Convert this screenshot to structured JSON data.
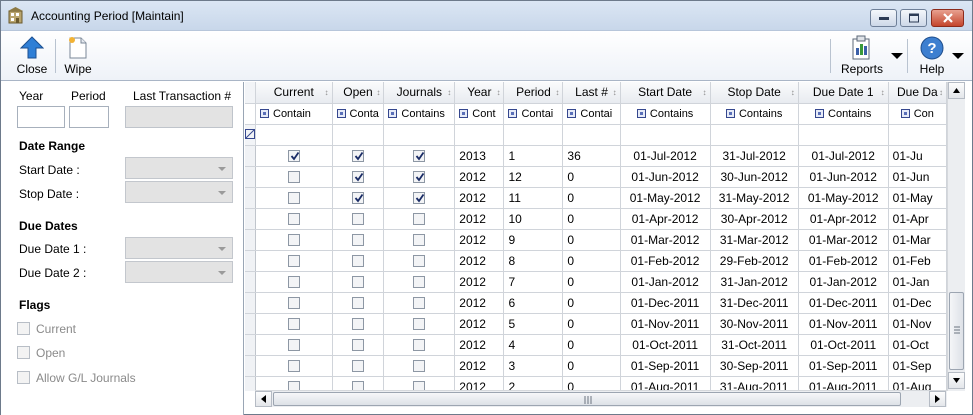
{
  "window": {
    "title": "Accounting Period [Maintain]",
    "icons": {
      "app": "building-icon",
      "minimize": "minimize-icon",
      "maximize": "maximize-icon",
      "close": "close-icon"
    }
  },
  "toolbar": {
    "close_label": "Close",
    "wipe_label": "Wipe",
    "reports_label": "Reports",
    "help_label": "Help"
  },
  "filters": {
    "year_label": "Year",
    "period_label": "Period",
    "last_transaction_label": "Last Transaction #",
    "date_range_heading": "Date Range",
    "start_date_label": "Start Date :",
    "stop_date_label": "Stop Date :",
    "due_dates_heading": "Due Dates",
    "due_date_1_label": "Due Date 1 :",
    "due_date_2_label": "Due Date 2 :",
    "flags_heading": "Flags",
    "flag_current": "Current",
    "flag_open": "Open",
    "flag_journals": "Allow G/L Journals"
  },
  "grid": {
    "columns": [
      "Current",
      "Open",
      "Journals",
      "Year",
      "Period",
      "Last #",
      "Start Date",
      "Stop Date",
      "Due Date 1",
      "Due Da"
    ],
    "filter_row": [
      "Contain",
      "Conta",
      "Contains",
      "Cont",
      "Contai",
      "Contai",
      "Contains",
      "Contains",
      "Contains",
      "Con"
    ],
    "rows": [
      {
        "current": true,
        "open": true,
        "journals": true,
        "year": "2013",
        "period": "1",
        "last": "36",
        "start": "01-Jul-2012",
        "stop": "31-Jul-2012",
        "due1": "01-Jul-2012",
        "due2": "01-Ju"
      },
      {
        "current": false,
        "open": true,
        "journals": true,
        "year": "2012",
        "period": "12",
        "last": "0",
        "start": "01-Jun-2012",
        "stop": "30-Jun-2012",
        "due1": "01-Jun-2012",
        "due2": "01-Jun"
      },
      {
        "current": false,
        "open": true,
        "journals": true,
        "year": "2012",
        "period": "11",
        "last": "0",
        "start": "01-May-2012",
        "stop": "31-May-2012",
        "due1": "01-May-2012",
        "due2": "01-May"
      },
      {
        "current": false,
        "open": false,
        "journals": false,
        "year": "2012",
        "period": "10",
        "last": "0",
        "start": "01-Apr-2012",
        "stop": "30-Apr-2012",
        "due1": "01-Apr-2012",
        "due2": "01-Apr"
      },
      {
        "current": false,
        "open": false,
        "journals": false,
        "year": "2012",
        "period": "9",
        "last": "0",
        "start": "01-Mar-2012",
        "stop": "31-Mar-2012",
        "due1": "01-Mar-2012",
        "due2": "01-Mar"
      },
      {
        "current": false,
        "open": false,
        "journals": false,
        "year": "2012",
        "period": "8",
        "last": "0",
        "start": "01-Feb-2012",
        "stop": "29-Feb-2012",
        "due1": "01-Feb-2012",
        "due2": "01-Feb"
      },
      {
        "current": false,
        "open": false,
        "journals": false,
        "year": "2012",
        "period": "7",
        "last": "0",
        "start": "01-Jan-2012",
        "stop": "31-Jan-2012",
        "due1": "01-Jan-2012",
        "due2": "01-Jan"
      },
      {
        "current": false,
        "open": false,
        "journals": false,
        "year": "2012",
        "period": "6",
        "last": "0",
        "start": "01-Dec-2011",
        "stop": "31-Dec-2011",
        "due1": "01-Dec-2011",
        "due2": "01-Dec"
      },
      {
        "current": false,
        "open": false,
        "journals": false,
        "year": "2012",
        "period": "5",
        "last": "0",
        "start": "01-Nov-2011",
        "stop": "30-Nov-2011",
        "due1": "01-Nov-2011",
        "due2": "01-Nov"
      },
      {
        "current": false,
        "open": false,
        "journals": false,
        "year": "2012",
        "period": "4",
        "last": "0",
        "start": "01-Oct-2011",
        "stop": "31-Oct-2011",
        "due1": "01-Oct-2011",
        "due2": "01-Oct"
      },
      {
        "current": false,
        "open": false,
        "journals": false,
        "year": "2012",
        "period": "3",
        "last": "0",
        "start": "01-Sep-2011",
        "stop": "30-Sep-2011",
        "due1": "01-Sep-2011",
        "due2": "01-Sep"
      },
      {
        "current": false,
        "open": false,
        "journals": false,
        "year": "2012",
        "period": "2",
        "last": "0",
        "start": "01-Aug-2011",
        "stop": "31-Aug-2011",
        "due1": "01-Aug-2011",
        "due2": "01-Aug"
      }
    ]
  }
}
